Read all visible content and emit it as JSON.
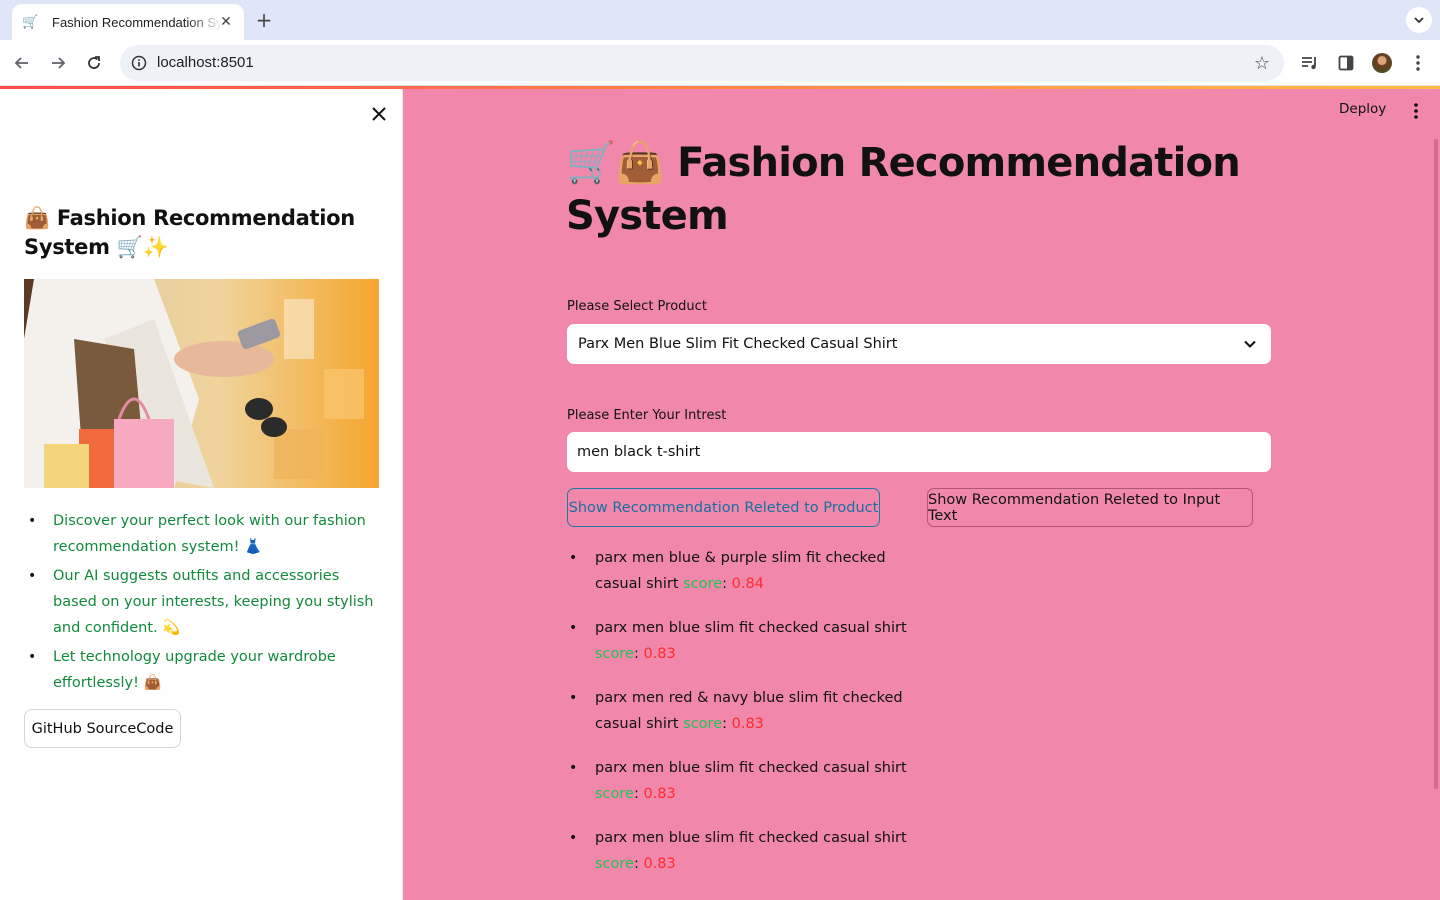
{
  "browser": {
    "tab_title": "Fashion Recommendation System",
    "tab_favicon": "🛒",
    "url": "localhost:8501"
  },
  "sidebar": {
    "title": "👜 Fashion Recommendation System 🛒✨",
    "bullets": [
      "Discover your perfect look with our fashion recommendation system! 👗",
      "Our AI suggests outfits and accessories based on your interests, keeping you stylish and confident. 💫",
      "Let technology upgrade your wardrobe effortlessly! 👜"
    ],
    "github_button": "GitHub SourceCode"
  },
  "header": {
    "deploy_label": "Deploy"
  },
  "main": {
    "title": "🛒👜 Fashion Recommendation System",
    "select_label": "Please Select Product",
    "select_value": "Parx Men Blue Slim Fit Checked Casual Shirt",
    "input_label": "Please Enter Your Intrest",
    "input_value": "men black t-shirt",
    "button_product": "Show Recommendation Releted to Product",
    "button_text": "Show Recommendation Releted to Input Text",
    "score_label": "score",
    "results": [
      {
        "name": "parx men blue & purple slim fit checked casual shirt",
        "score": "0.84"
      },
      {
        "name": "parx men blue slim fit checked casual shirt",
        "score": "0.83"
      },
      {
        "name": "parx men red & navy blue slim fit checked casual shirt",
        "score": "0.83"
      },
      {
        "name": "parx men blue slim fit checked casual shirt",
        "score": "0.83"
      },
      {
        "name": "parx men blue slim fit checked casual shirt",
        "score": "0.83"
      }
    ]
  },
  "colors": {
    "main_background": "#f188ab",
    "sidebar_text": "#128a3c",
    "score_label": "#21c354",
    "score_value": "#ff2b2b"
  }
}
